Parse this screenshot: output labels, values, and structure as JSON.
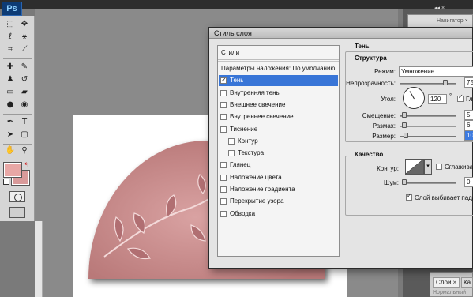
{
  "app": {
    "logo": "Ps"
  },
  "colors": {
    "foreground": "#e8a7a5",
    "background": "#d99a9a",
    "selection": "#3875d7",
    "art_fill": "#c98c8c"
  },
  "toolbox": {
    "tools": [
      "marquee-icon",
      "move-icon",
      "lasso-icon",
      "magic-wand-icon",
      "crop-icon",
      "slice-icon",
      "healing-icon",
      "brush-icon",
      "clone-stamp-icon",
      "history-brush-icon",
      "eraser-icon",
      "gradient-icon",
      "blur-icon",
      "dodge-icon",
      "pen-icon",
      "type-icon",
      "path-select-icon",
      "shape-icon",
      "notes-icon",
      "eyedropper-icon",
      "hand-icon",
      "zoom-icon"
    ]
  },
  "right_panel": {
    "tab_label": "Навигатор ×"
  },
  "layers_panel": {
    "tab_label": "Слои",
    "tab_close": "×",
    "tab2_label": "Ка",
    "blend_mode": "Нормальный"
  },
  "dialog": {
    "title": "Стиль слоя",
    "styles_header": "Стили",
    "styles": [
      {
        "label": "Параметры наложения: По умолчанию",
        "checkbox": false,
        "checked": false,
        "selected": false,
        "indent": false
      },
      {
        "label": "Тень",
        "checkbox": true,
        "checked": true,
        "selected": true,
        "indent": false
      },
      {
        "label": "Внутренняя тень",
        "checkbox": true,
        "checked": false,
        "selected": false,
        "indent": false
      },
      {
        "label": "Внешнее свечение",
        "checkbox": true,
        "checked": false,
        "selected": false,
        "indent": false
      },
      {
        "label": "Внутреннее свечение",
        "checkbox": true,
        "checked": false,
        "selected": false,
        "indent": false
      },
      {
        "label": "Тиснение",
        "checkbox": true,
        "checked": false,
        "selected": false,
        "indent": false
      },
      {
        "label": "Контур",
        "checkbox": true,
        "checked": false,
        "selected": false,
        "indent": true
      },
      {
        "label": "Текстура",
        "checkbox": true,
        "checked": false,
        "selected": false,
        "indent": true
      },
      {
        "label": "Глянец",
        "checkbox": true,
        "checked": false,
        "selected": false,
        "indent": false
      },
      {
        "label": "Наложение цвета",
        "checkbox": true,
        "checked": false,
        "selected": false,
        "indent": false
      },
      {
        "label": "Наложение градиента",
        "checkbox": true,
        "checked": false,
        "selected": false,
        "indent": false
      },
      {
        "label": "Перекрытие узора",
        "checkbox": true,
        "checked": false,
        "selected": false,
        "indent": false
      },
      {
        "label": "Обводка",
        "checkbox": true,
        "checked": false,
        "selected": false,
        "indent": false
      }
    ],
    "shadow": {
      "section_title": "Тень",
      "structure_title": "Структура",
      "blend_mode_label": "Режим:",
      "blend_mode_value": "Умножение",
      "opacity_label": "Непрозрачность:",
      "opacity_value": "75",
      "angle_label": "Угол:",
      "angle_value": "120",
      "angle_unit": "°",
      "global_light_label": "Гло",
      "global_light_checked": true,
      "distance_label": "Смещение:",
      "distance_value": "5",
      "spread_label": "Размах:",
      "spread_value": "6",
      "size_label": "Размер:",
      "size_value": "10",
      "quality_title": "Качество",
      "contour_label": "Контур:",
      "antialias_label": "Сглаживан",
      "antialias_checked": false,
      "noise_label": "Шум:",
      "noise_value": "0",
      "knockout_label": "Слой выбивает падаю",
      "knockout_checked": true
    }
  }
}
